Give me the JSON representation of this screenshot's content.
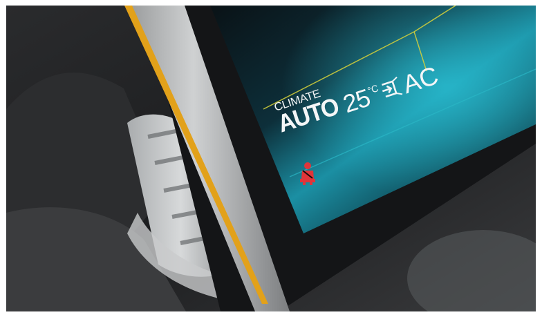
{
  "display": {
    "climate_label": "CLIMATE",
    "mode": "AUTO",
    "temperature": "25",
    "temperature_unit": "°C",
    "ac_label": "AC"
  },
  "icons": {
    "recirculation": "air-recirculation-icon",
    "seatbelt_warning": "seatbelt-warning-icon"
  },
  "colors": {
    "bezel_accent": "#e2a11a",
    "screen_cyan": "#1f9eb0",
    "screen_yellow_line": "#d8d23a",
    "seatbelt_red": "#e0353a",
    "text": "#f2f5f6"
  }
}
